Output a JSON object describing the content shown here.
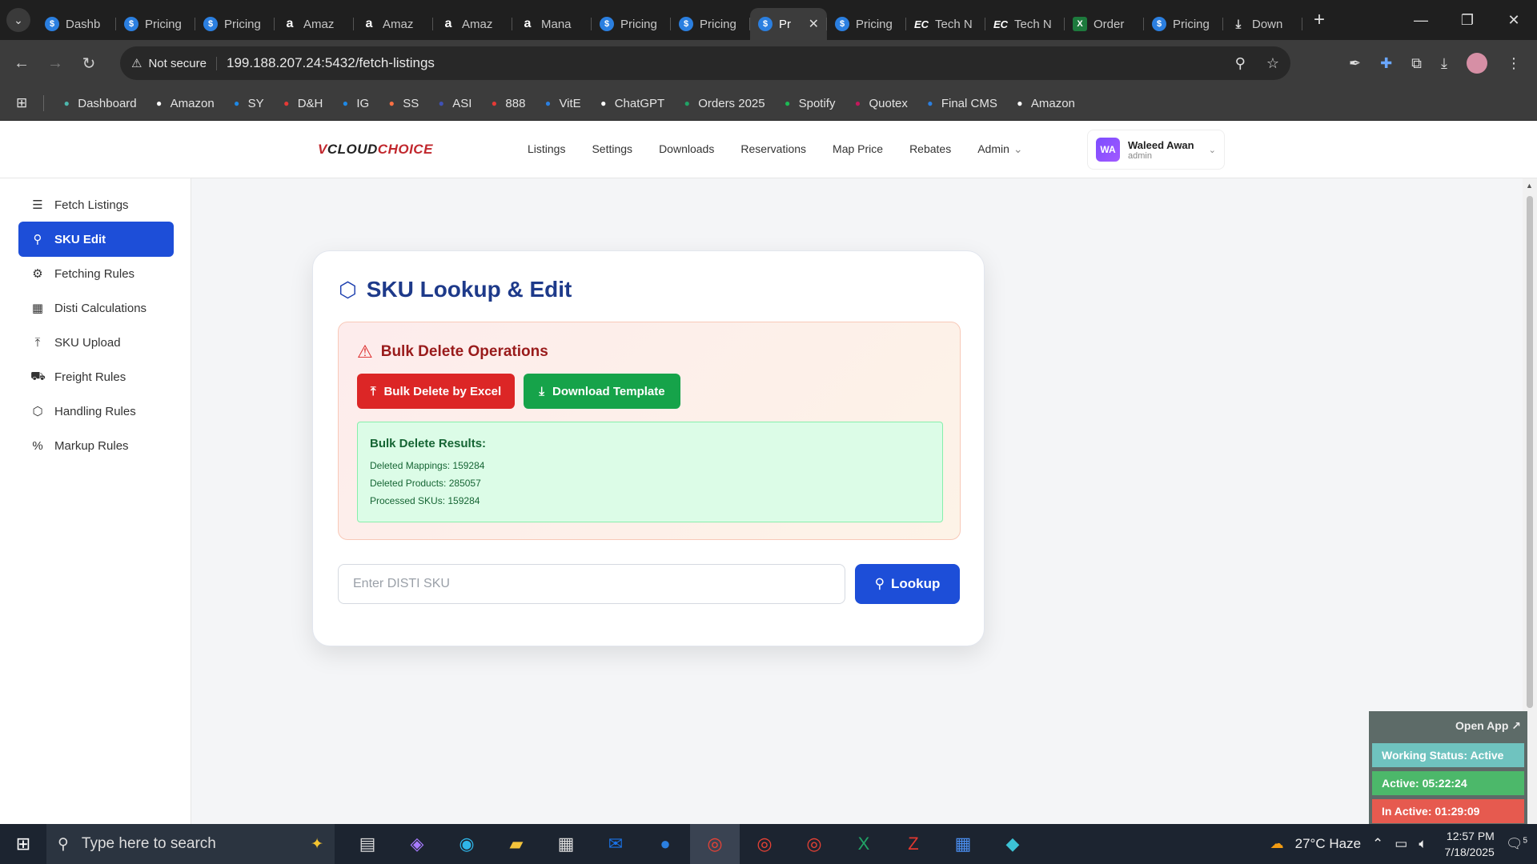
{
  "browser": {
    "tabs": [
      {
        "icon": "dollar",
        "label": "Dashb"
      },
      {
        "icon": "dollar",
        "label": "Pricing"
      },
      {
        "icon": "dollar",
        "label": "Pricing"
      },
      {
        "icon": "amazon",
        "label": "Amaz"
      },
      {
        "icon": "amazon",
        "label": "Amaz"
      },
      {
        "icon": "amazon",
        "label": "Amaz"
      },
      {
        "icon": "amazon",
        "label": "Mana"
      },
      {
        "icon": "dollar",
        "label": "Pricing"
      },
      {
        "icon": "dollar",
        "label": "Pricing"
      },
      {
        "icon": "dollar",
        "label": "Pr"
      },
      {
        "icon": "dollar",
        "label": "Pricing"
      },
      {
        "icon": "ec",
        "label": "Tech N"
      },
      {
        "icon": "ec",
        "label": "Tech N"
      },
      {
        "icon": "excel",
        "label": "Order"
      },
      {
        "icon": "dollar",
        "label": "Pricing"
      },
      {
        "icon": "download",
        "label": "Down"
      }
    ],
    "active_tab_index": 9,
    "security_label": "Not secure",
    "url": "199.188.207.24:5432/fetch-listings",
    "bookmarks": [
      "Dashboard",
      "Amazon",
      "SY",
      "D&H",
      "IG",
      "SS",
      "ASI",
      "888",
      "VitE",
      "ChatGPT",
      "Orders 2025",
      "Spotify",
      "Quotex",
      "Final CMS",
      "Amazon"
    ]
  },
  "app": {
    "logo_prefix": "V",
    "logo_cloud": "CLOUD",
    "logo_choice": "CHOICE",
    "nav": [
      "Listings",
      "Settings",
      "Downloads",
      "Reservations",
      "Map Price",
      "Rebates",
      "Admin"
    ],
    "user": {
      "initials": "WA",
      "name": "Waleed Awan",
      "role": "admin"
    },
    "sidebar": [
      {
        "label": "Fetch Listings",
        "icon": "list-icon"
      },
      {
        "label": "SKU Edit",
        "icon": "search-icon"
      },
      {
        "label": "Fetching Rules",
        "icon": "gear-icon"
      },
      {
        "label": "Disti Calculations",
        "icon": "calculator-icon"
      },
      {
        "label": "SKU Upload",
        "icon": "upload-icon"
      },
      {
        "label": "Freight Rules",
        "icon": "truck-icon"
      },
      {
        "label": "Handling Rules",
        "icon": "box-icon"
      },
      {
        "label": "Markup Rules",
        "icon": "percent-icon"
      }
    ],
    "active_sidebar": "SKU Edit"
  },
  "card": {
    "title": "SKU Lookup & Edit",
    "bulk": {
      "title": "Bulk Delete Operations",
      "delete_button": "Bulk Delete by Excel",
      "template_button": "Download Template",
      "results_heading": "Bulk Delete Results:",
      "deleted_mappings": "Deleted Mappings: 159284",
      "deleted_products": "Deleted Products: 285057",
      "processed_skus": "Processed SKUs: 159284"
    },
    "input_placeholder": "Enter DISTI SKU",
    "lookup_button": "Lookup"
  },
  "widget": {
    "open_app": "Open App ↗",
    "working_status": "Working Status: Active",
    "active": "Active: 05:22:24",
    "inactive": "In Active: 01:29:09",
    "colors": {
      "status": "#6fc3bf",
      "active": "#4cb86a",
      "inactive": "#e65a4f"
    }
  },
  "taskbar": {
    "search_placeholder": "Type here to search",
    "weather": "27°C Haze",
    "time": "12:57 PM",
    "date": "7/18/2025",
    "notification_count": "5"
  },
  "colors": {
    "accent": "#1d4ed8",
    "danger": "#dc2626",
    "success": "#16a34a",
    "title": "#1e3a8a"
  }
}
